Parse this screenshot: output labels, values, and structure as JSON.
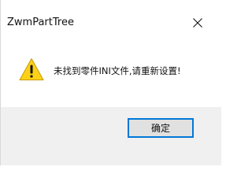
{
  "window": {
    "title": "ZwmPartTree",
    "close_label": "✕"
  },
  "dialog": {
    "icon": "warning-icon",
    "message": "未找到零件INI文件,请重新设置!"
  },
  "buttons": {
    "ok_label": "确定"
  },
  "colors": {
    "warning_fill": "#fcd116",
    "focus_border": "#0078d7",
    "footer_bg": "#f0f0f0"
  }
}
